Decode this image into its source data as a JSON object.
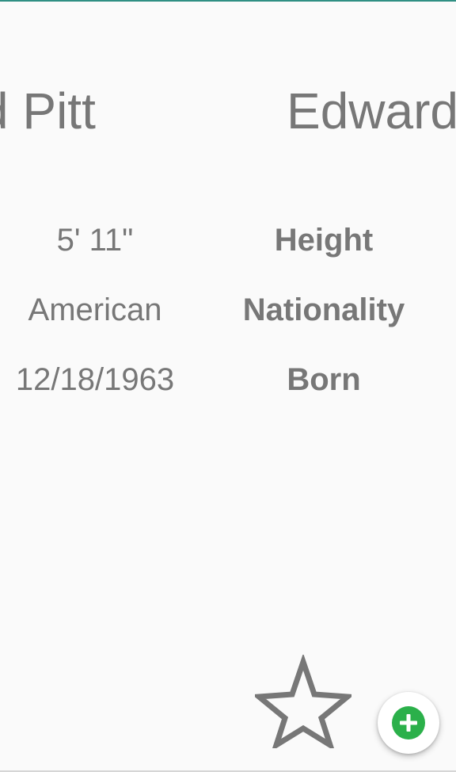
{
  "colors": {
    "accent_top": "#2f8f83",
    "text": "#777777",
    "background": "#fafafa",
    "fab_icon": "#2bb04a",
    "star_stroke": "#777777"
  },
  "cards": [
    {
      "name_fragment": "d Pitt"
    },
    {
      "name_fragment": "Edward"
    }
  ],
  "details": {
    "height": {
      "label": "Height",
      "value": "5' 11\""
    },
    "nationality": {
      "label": "Nationality",
      "value": "American"
    },
    "born": {
      "label": "Born",
      "value": "12/18/1963"
    }
  },
  "actions": {
    "favorite_icon": "star-outline-icon",
    "add_icon": "plus-circle-icon"
  }
}
